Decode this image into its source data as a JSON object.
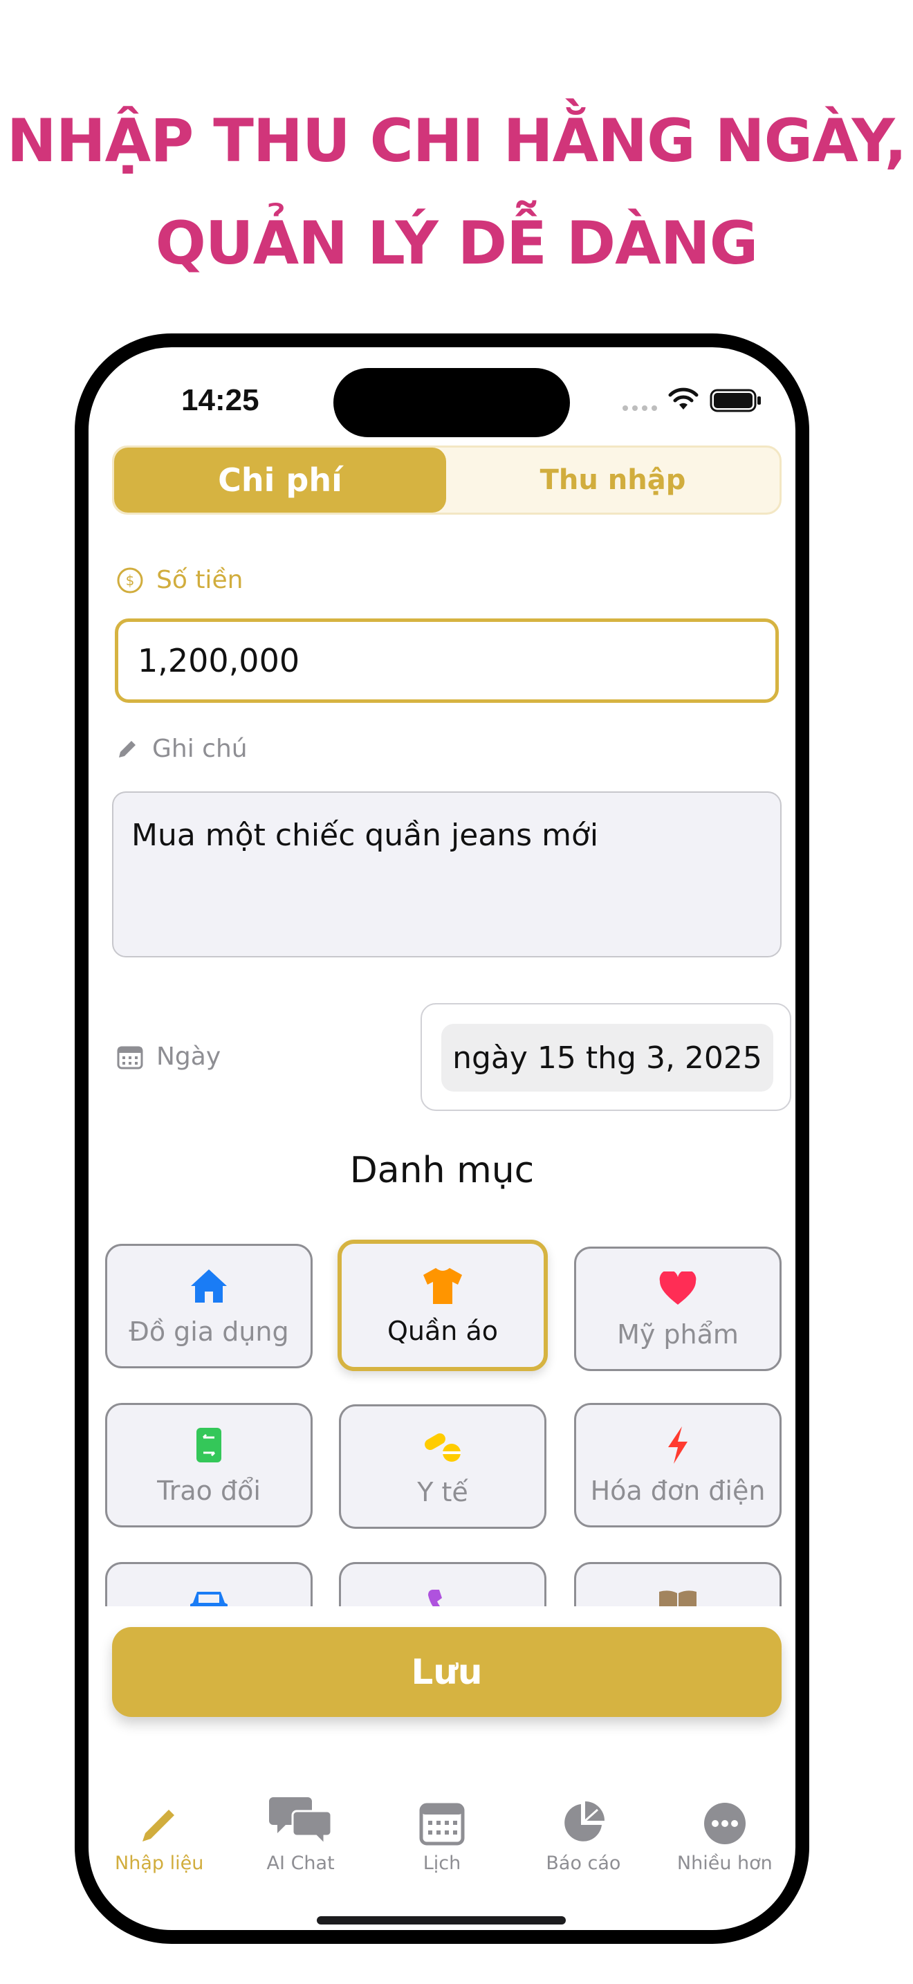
{
  "headline": {
    "line1": "NHẬP THU CHI HẰNG NGÀY,",
    "line2": "QUẢN LÝ DỄ DÀNG"
  },
  "status_bar": {
    "time": "14:25"
  },
  "segment": {
    "expense_label": "Chi phí",
    "income_label": "Thu nhập",
    "selected": "expense"
  },
  "amount": {
    "label": "Số tiền",
    "value": "1,200,000"
  },
  "note": {
    "label": "Ghi chú",
    "value": "Mua một chiếc quần jeans mới"
  },
  "date": {
    "label": "Ngày",
    "value": "ngày 15 thg 3, 2025"
  },
  "category": {
    "title": "Danh mục",
    "items": [
      {
        "label": "Đồ gia dụng",
        "icon": "house-icon",
        "color": "#1a7cf5",
        "selected": false
      },
      {
        "label": "Quần áo",
        "icon": "tshirt-icon",
        "color": "#ff9500",
        "selected": true
      },
      {
        "label": "Mỹ phẩm",
        "icon": "heart-icon",
        "color": "#ff2d55",
        "selected": false
      },
      {
        "label": "Trao đổi",
        "icon": "exchange-icon",
        "color": "#34c759",
        "selected": false
      },
      {
        "label": "Y tế",
        "icon": "pills-icon",
        "color": "#ffcc00",
        "selected": false
      },
      {
        "label": "Hóa đơn điện",
        "icon": "bolt-icon",
        "color": "#ff3b30",
        "selected": false
      },
      {
        "label": "",
        "icon": "car-icon",
        "color": "#1a7cf5",
        "selected": false
      },
      {
        "label": "",
        "icon": "phone-icon",
        "color": "#af52de",
        "selected": false
      },
      {
        "label": "",
        "icon": "book-icon",
        "color": "#a2845e",
        "selected": false
      }
    ]
  },
  "save_label": "Lưu",
  "tabs": [
    {
      "label": "Nhập liệu",
      "icon": "pencil-icon",
      "active": true
    },
    {
      "label": "AI Chat",
      "icon": "chat-bubbles-icon",
      "active": false
    },
    {
      "label": "Lịch",
      "icon": "calendar-icon",
      "active": false
    },
    {
      "label": "Báo cáo",
      "icon": "pie-chart-icon",
      "active": false
    },
    {
      "label": "Nhiều hơn",
      "icon": "more-icon",
      "active": false
    }
  ],
  "colors": {
    "accent": "#d6b341",
    "headline": "#d1357a"
  }
}
